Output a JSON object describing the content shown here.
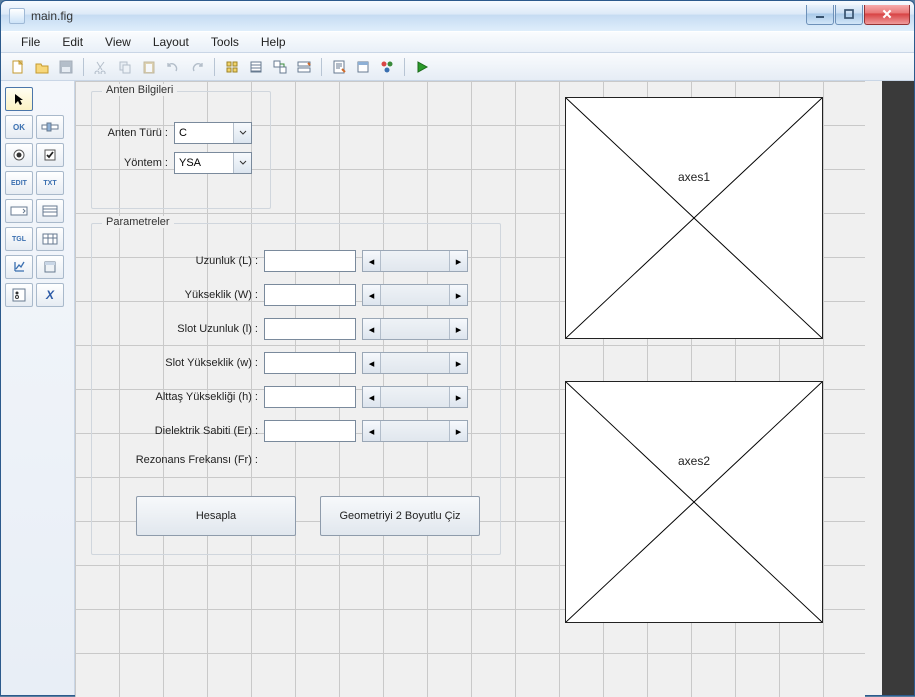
{
  "window": {
    "title": "main.fig"
  },
  "menu": {
    "items": [
      "File",
      "Edit",
      "View",
      "Layout",
      "Tools",
      "Help"
    ]
  },
  "palette": {
    "r0": {
      "a": "↖"
    },
    "r1": {
      "a": "OK",
      "b": "▭"
    },
    "r2": {
      "a": "◉",
      "b": "☑"
    },
    "r3": {
      "a": "EDIT",
      "b": "TXT"
    },
    "r4": {
      "a": "▦",
      "b": "▤"
    },
    "r5": {
      "a": "TGL",
      "b": "▭"
    },
    "r6": {
      "a": "⧉",
      "b": "▣"
    },
    "r7": {
      "a": "◧",
      "b": "X"
    }
  },
  "group1": {
    "legend": "Anten Bilgileri",
    "row1": {
      "label": "Anten Türü :",
      "value": "C"
    },
    "row2": {
      "label": "Yöntem :",
      "value": "YSA"
    }
  },
  "group2": {
    "legend": "Parametreler",
    "rows": [
      {
        "label": "Uzunluk (L) :",
        "value": ""
      },
      {
        "label": "Yükseklik (W) :",
        "value": ""
      },
      {
        "label": "Slot Uzunluk (l) :",
        "value": ""
      },
      {
        "label": "Slot Yükseklik (w) :",
        "value": ""
      },
      {
        "label": "Alttaş Yüksekliği (h) :",
        "value": ""
      },
      {
        "label": "Dielektrik Sabiti (Er) :",
        "value": ""
      }
    ],
    "resonance_label": "Rezonans Frekansı (Fr) :",
    "btn_calc": "Hesapla",
    "btn_draw": "Geometriyi 2 Boyutlu Çiz"
  },
  "axes": {
    "label1": "axes1",
    "label2": "axes2"
  }
}
